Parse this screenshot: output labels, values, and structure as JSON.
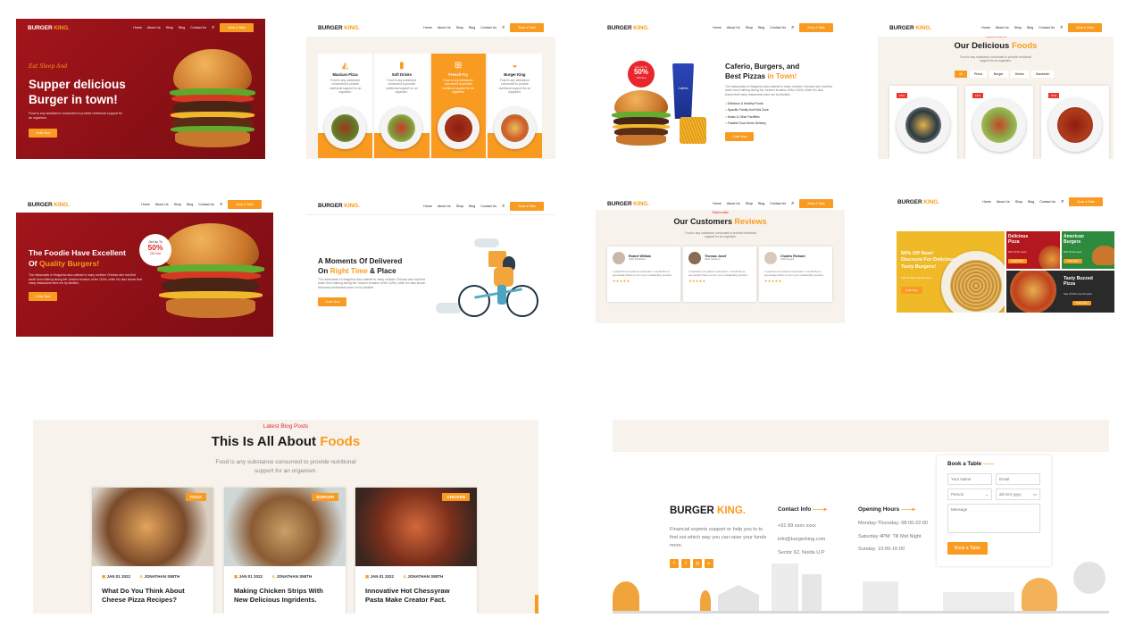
{
  "brand": {
    "name": "BURGER",
    "accent": "KING."
  },
  "nav": {
    "links": [
      "Home",
      "About Us",
      "Shop",
      "Blog",
      "Contact Us"
    ],
    "cta": "Book a Table"
  },
  "colors": {
    "accent": "#f99b21",
    "hero_red": "#9a1318",
    "cream": "#f7f3ec"
  },
  "hero1": {
    "script": "Eat Sleep And",
    "title_line1": "Supper delicious",
    "title_line2": "Burger in town!",
    "desc": "Food is any substance consumed to provide nutritional support for an organism.",
    "button": "Order Now"
  },
  "categories": {
    "items": [
      {
        "title": "Maxican Pizza",
        "desc": "Food is any substance consumed to provide nutritional support for an organism."
      },
      {
        "title": "Soft Drinks",
        "desc": "Food is any substance consumed to provide nutritional support for an organism."
      },
      {
        "title": "French Fry",
        "desc": "Food is any substance consumed to provide nutritional support for an organism."
      },
      {
        "title": "Burger King",
        "desc": "Food is any substance consumed to provide nutritional support for an organism."
      }
    ]
  },
  "about": {
    "badge_small": "Get Up To",
    "badge_big": "50%",
    "badge_off": "Off Now",
    "title_line1": "Caferio, Burgers, and",
    "title_line2": "Best Pizzas",
    "title_accent": "in Town!",
    "desc": "The restaurants in Hangzhou also catered to many northern Chinese who had fled south from Kaifeng during the Jurchen invasion of the 1120s, while it is also known that many restaurants were run by families.",
    "features": [
      "Delicious & Healthy Foods",
      "Spacific Family And Kids Zone",
      "Music & Other Facilities",
      "Fastest Food Home Delivery"
    ],
    "button": "Order Now",
    "cup_label": "Caferio"
  },
  "menu": {
    "eyebrow": "Popular Dishes",
    "title": "Our Delicious",
    "title_accent": "Foods",
    "desc": "Food is any substance consumed to provide nutritional support for an organism.",
    "filters": [
      "All",
      "Pizza",
      "Burger",
      "Drinks",
      "Sandwich"
    ],
    "badges": [
      "15%",
      "15%",
      "15%"
    ]
  },
  "hero2": {
    "title_line1": "The Foodie Have Excellent",
    "title_line2": "Of",
    "title_accent": "Quality Burgers!",
    "desc": "The restaurants in Hangzhou also catered to many northern Chinese who had fled south from Kaifeng during the Jurchen invasion of the 1120s, while it is also known that many restaurants were run by families.",
    "button": "Order Now",
    "badge_small": "Get Up To",
    "badge_big": "50%",
    "badge_off": "Off Now"
  },
  "delivery": {
    "title_line1": "A Moments Of Delivered",
    "title_pre": "On",
    "title_accent": "Right Time",
    "title_post": "& Place",
    "desc": "The restaurants in Hangzhou also catered to many northern Chinese who had fled south from Kaifeng during the Jurchen invasion of the 1120s, while it is also known that many restaurants were run by families.",
    "button": "Order Now"
  },
  "reviews": {
    "eyebrow": "Testimonials",
    "title": "Our Customers",
    "title_accent": "Reviews",
    "desc": "Food is any substance consumed to provide nutritional support for an organism.",
    "items": [
      {
        "name": "Robert William",
        "role": "CEO Kingfisher",
        "text": "I would be lost without restaurant. I would like to personally thank you for your outstanding product.",
        "stars": "★★★★★"
      },
      {
        "name": "Thomas Josef",
        "role": "CEO Getforce",
        "text": "I would be lost without restaurant. I would like to personally thank you for your outstanding product.",
        "stars": "★★★★★"
      },
      {
        "name": "Charles Richard",
        "role": "CEO Angela",
        "text": "I would be lost without restaurant. I would like to personally thank you for your outstanding product.",
        "stars": "★★★★★"
      }
    ]
  },
  "promo": {
    "big_title1": "50% Off Now!",
    "big_title2": "Discount For Delicious",
    "big_title3": "Tasty Burgers!",
    "big_desc": "Sale off 50% only this week",
    "big_button": "Order Now",
    "p1_title1": "Delicious",
    "p1_title2": "Pizza",
    "p1_sub": "50% off this week",
    "p1_button": "Order Now",
    "p2_title1": "American",
    "p2_title2": "Burgers",
    "p2_sub": "50% off this week",
    "p2_button": "Order Now",
    "p3_title1": "Tasty Buzzed",
    "p3_title2": "Pizza",
    "p3_sub": "Sale off 50% only this week",
    "p3_button": "Order Now"
  },
  "blog": {
    "eyebrow": "Latest Blog Posts",
    "title": "This Is All About",
    "title_accent": "Foods",
    "desc_line1": "Food is any substance consumed to provide nutritional",
    "desc_line2": "support for an organism.",
    "posts": [
      {
        "tag": "PIZZA",
        "date": "JAN 01 2022",
        "author": "JONATHAN SMITH",
        "title_line1": "What Do You Think About",
        "title_line2": "Cheese Pizza Recipes?"
      },
      {
        "tag": "BURGER",
        "date": "JAN 01 2022",
        "author": "JONATHAN SMITH",
        "title_line1": "Making Chicken Strips With",
        "title_line2": "New Delicious Ingridents."
      },
      {
        "tag": "CHICKEN",
        "date": "JAN 01 2022",
        "author": "JONATHAN SMITH",
        "title_line1": "Innovative Hot Chessyraw",
        "title_line2": "Pasta Make Creator Fact."
      }
    ]
  },
  "footer": {
    "desc": "Financial experts support or help you to to find out which way you can raise your funds more.",
    "contact_title": "Contact Info",
    "contact": [
      "+91 89 xxxx xxxx",
      "info@burgerking.com",
      "Sector 62, Noida U.P"
    ],
    "hours_title": "Opening Hours",
    "hours": [
      "Monday-Thursday: 08:00-22:00",
      "Saturday 4PM: Till Mid Night",
      "Sunday: 10:00-16:00"
    ],
    "book": {
      "title": "Book a Table",
      "name_ph": "Your Name",
      "email_ph": "Email",
      "person": "Person",
      "date_ph": "dd-mm-yyyy",
      "message_ph": "Message",
      "button": "Book a Table"
    }
  }
}
